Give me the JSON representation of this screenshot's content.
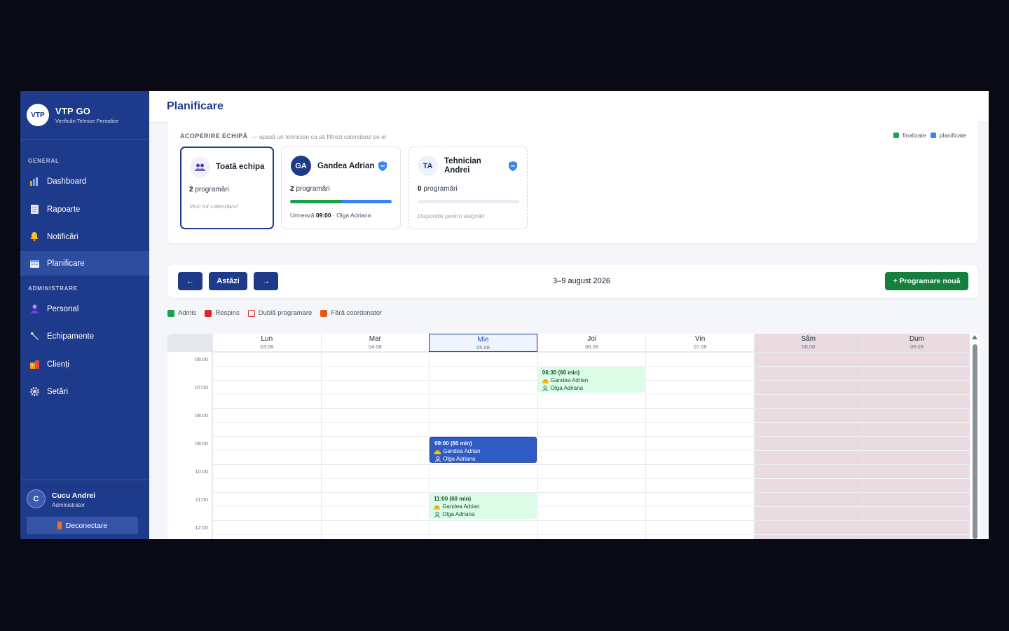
{
  "brand": {
    "logo": "VTP",
    "title": "VTP GO",
    "subtitle": "Verificări Tehnice Periodice"
  },
  "nav": {
    "section_general": "GENERAL",
    "section_admin": "ADMINISTRARE",
    "items": [
      {
        "label": "Dashboard",
        "icon": "chart-icon"
      },
      {
        "label": "Rapoarte",
        "icon": "document-icon"
      },
      {
        "label": "Notificări",
        "icon": "bell-icon"
      },
      {
        "label": "Planificare",
        "icon": "calendar-icon",
        "active": true
      },
      {
        "label": "Personal",
        "icon": "person-icon"
      },
      {
        "label": "Echipamente",
        "icon": "wrench-icon"
      },
      {
        "label": "Clienți",
        "icon": "building-icon"
      },
      {
        "label": "Setări",
        "icon": "gear-icon"
      }
    ]
  },
  "user": {
    "initial": "C",
    "name": "Cucu Andrei",
    "role": "Administrator",
    "logout": "Deconectare"
  },
  "header": {
    "title": "Planificare"
  },
  "coverage": {
    "label": "ACOPERIRE ECHIPĂ",
    "hint": "— apasă un tehnician ca să filtrezi calendarul pe el",
    "legend_done": "finalizate",
    "legend_planned": "planificate",
    "colors": {
      "done": "#16a34a",
      "planned": "#3b82f6"
    },
    "cards": [
      {
        "name": "Toată echipa",
        "count": "2",
        "count_label": "programări",
        "footer": "Vezi tot calendarul"
      },
      {
        "initials": "GA",
        "name": "Gandea Adrian",
        "count": "2",
        "count_label": "programări",
        "next_label": "Urmează",
        "next_time": "09:00",
        "next_rest": "· Olga Adriana",
        "done_fraction": 0.5
      },
      {
        "initials": "TA",
        "name": "Tehnician Andrei",
        "count": "0",
        "count_label": "programări",
        "footer": "Disponibil pentru asignări"
      }
    ]
  },
  "toolbar": {
    "prev": "←",
    "today": "Astăzi",
    "next": "→",
    "week": "3–9 august 2026",
    "new_button": "+ Programare nouă"
  },
  "status_legend": [
    {
      "label": "Admis",
      "color": "#16a34a",
      "style": "fill"
    },
    {
      "label": "Respins",
      "color": "#dc2626",
      "style": "fill"
    },
    {
      "label": "Dublă programare",
      "color": "#dc2626",
      "style": "outline"
    },
    {
      "label": "Fără coordonator",
      "color": "#ea580c",
      "style": "fill"
    }
  ],
  "calendar": {
    "days": [
      {
        "name": "Lun",
        "date": "03.08"
      },
      {
        "name": "Mar",
        "date": "04.08"
      },
      {
        "name": "Mie",
        "date": "05.08",
        "today": true
      },
      {
        "name": "Joi",
        "date": "06.08"
      },
      {
        "name": "Vin",
        "date": "07.08"
      },
      {
        "name": "Sâm",
        "date": "08.08",
        "weekend": true
      },
      {
        "name": "Dum",
        "date": "09.08",
        "weekend": true
      }
    ],
    "hours": [
      "06:00",
      "07:00",
      "08:00",
      "09:00",
      "10:00",
      "11:00",
      "12:00"
    ],
    "events": [
      {
        "day": 3,
        "start": "06:30",
        "time": "06:30 (60 min)",
        "tech": "Gandea Adrian",
        "client": "Olga Adriana",
        "status": "done"
      },
      {
        "day": 2,
        "start": "09:00",
        "time": "09:00 (60 min)",
        "tech": "Gandea Adrian",
        "client": "Olga Adriana",
        "status": "planned"
      },
      {
        "day": 2,
        "start": "11:00",
        "time": "11:00 (60 min)",
        "tech": "Gandea Adrian",
        "client": "Olga Adriana",
        "status": "done"
      }
    ]
  }
}
